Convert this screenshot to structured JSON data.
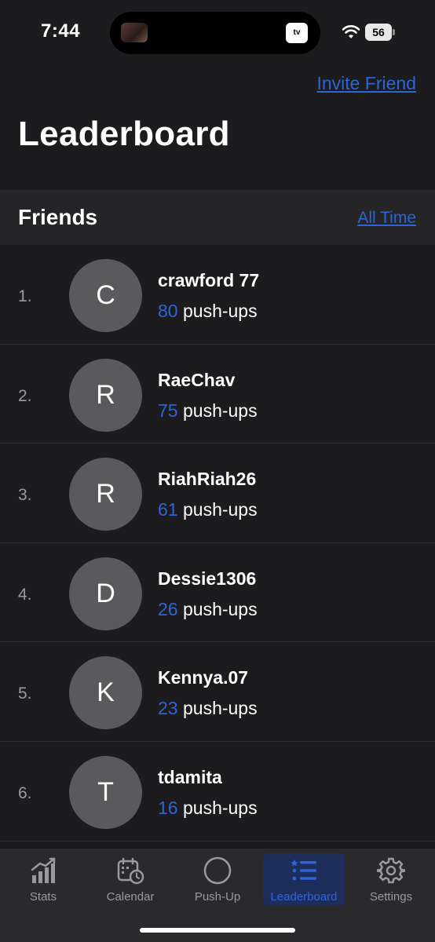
{
  "status_bar": {
    "time": "7:44",
    "tv_label": "tv",
    "battery": "56"
  },
  "header": {
    "invite_link": "Invite Friend",
    "title": "Leaderboard"
  },
  "section": {
    "title": "Friends",
    "filter_link": "All Time"
  },
  "push_unit": "push-ups",
  "leaderboard": [
    {
      "rank": "1.",
      "initial": "C",
      "username": "crawford 77",
      "count": "80"
    },
    {
      "rank": "2.",
      "initial": "R",
      "username": "RaeChav",
      "count": "75"
    },
    {
      "rank": "3.",
      "initial": "R",
      "username": "RiahRiah26",
      "count": "61"
    },
    {
      "rank": "4.",
      "initial": "D",
      "username": "Dessie1306",
      "count": "26"
    },
    {
      "rank": "5.",
      "initial": "K",
      "username": "Kennya.07",
      "count": "23"
    },
    {
      "rank": "6.",
      "initial": "T",
      "username": "tdamita",
      "count": "16"
    }
  ],
  "tabs": [
    {
      "label": "Stats",
      "icon": "stats-chart-icon"
    },
    {
      "label": "Calendar",
      "icon": "calendar-clock-icon"
    },
    {
      "label": "Push-Up",
      "icon": "circle-icon"
    },
    {
      "label": "Leaderboard",
      "icon": "list-icon",
      "active": true
    },
    {
      "label": "Settings",
      "icon": "gear-icon"
    }
  ],
  "colors": {
    "accent": "#2f63d8",
    "background": "#1c1c1e",
    "avatar": "#5a5a5c",
    "tab_active_bg": "#1d2e5a"
  }
}
